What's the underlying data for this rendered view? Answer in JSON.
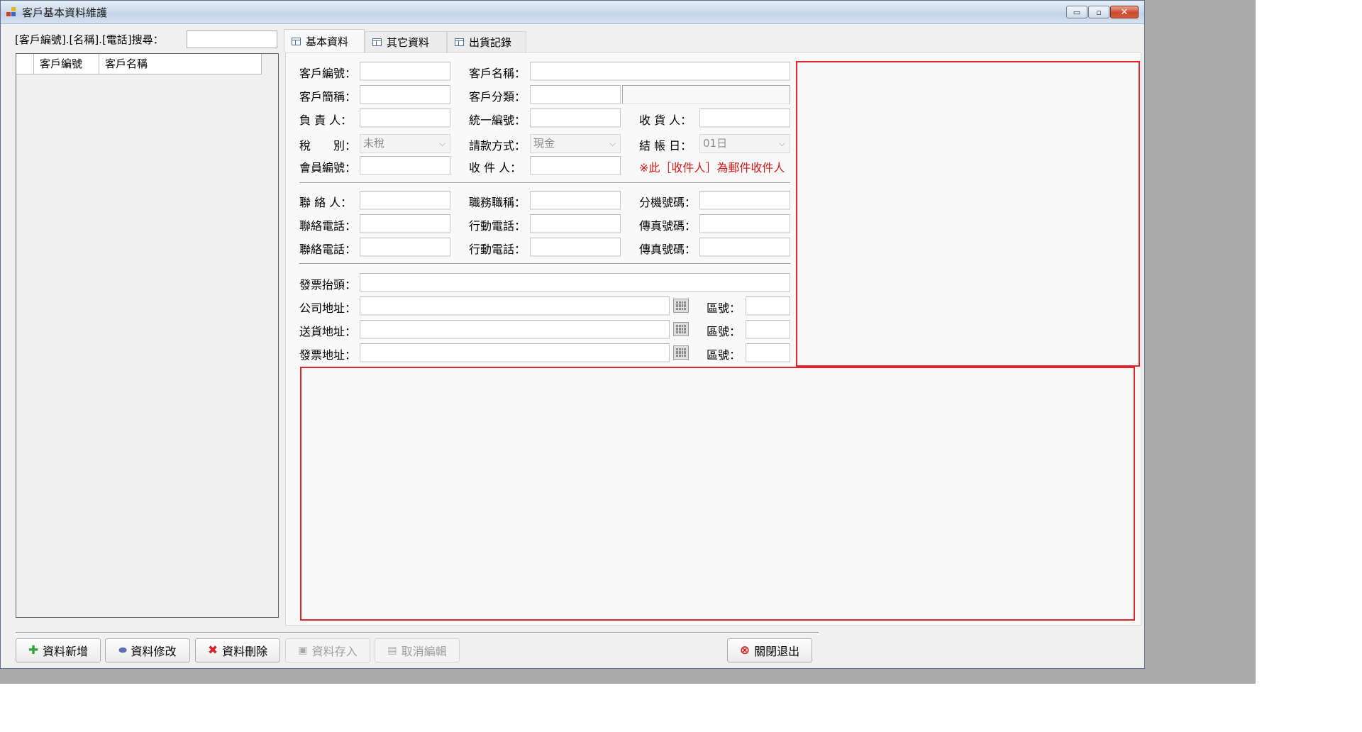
{
  "window": {
    "title": "客戶基本資料維護",
    "controls": {
      "minimize": "▭",
      "restore": "▫",
      "close": "✕"
    }
  },
  "search": {
    "label": "[客戶編號].[名稱].[電話]搜尋：",
    "value": ""
  },
  "grid": {
    "columns": [
      "客戶編號",
      "客戶名稱"
    ]
  },
  "tabs": [
    {
      "label": "基本資料",
      "active": true
    },
    {
      "label": "其它資料",
      "active": false
    },
    {
      "label": "出貨記錄",
      "active": false
    }
  ],
  "form": {
    "customer_no_label": "客戶編號：",
    "customer_name_label": "客戶名稱：",
    "customer_short_label": "客戶簡稱：",
    "customer_category_label": "客戶分類：",
    "owner_label": "負 責 人：",
    "tax_id_label": "統一編號：",
    "receiver_label": "收 貨 人：",
    "tax_type_label": "稅　　別：",
    "tax_type_value": "未稅",
    "payment_method_label": "請款方式：",
    "payment_method_value": "現金",
    "closing_day_label": "結 帳 日：",
    "closing_day_value": "01日",
    "member_no_label": "會員編號：",
    "recipient_label": "收 件 人：",
    "recipient_note": "※此［收件人］為郵件收件人",
    "contact_label": "聯 絡 人：",
    "job_title_label": "職務職稱：",
    "extension_label": "分機號碼：",
    "phone1_label": "聯絡電話：",
    "mobile1_label": "行動電話：",
    "fax1_label": "傳真號碼：",
    "phone2_label": "聯絡電話：",
    "mobile2_label": "行動電話：",
    "fax2_label": "傳真號碼：",
    "invoice_title_label": "發票抬頭：",
    "company_addr_label": "公司地址：",
    "delivery_addr_label": "送貨地址：",
    "invoice_addr_label": "發票地址：",
    "zip_label": "區號："
  },
  "buttons": {
    "add": {
      "label": "資料新增",
      "icon": "plus-icon",
      "color": "#2fa33a"
    },
    "edit": {
      "label": "資料修改",
      "icon": "eraser-icon",
      "color": "#5a6fb0"
    },
    "delete": {
      "label": "資料刪除",
      "icon": "x-icon",
      "color": "#d42424"
    },
    "save": {
      "label": "資料存入",
      "icon": "floppy-icon"
    },
    "cancel": {
      "label": "取消編輯",
      "icon": "doc-icon"
    },
    "exit": {
      "label": "關閉退出",
      "icon": "close-circle-icon",
      "color": "#d42424"
    }
  },
  "colors": {
    "highlight": "#e0242b",
    "note": "#d11a1a"
  }
}
